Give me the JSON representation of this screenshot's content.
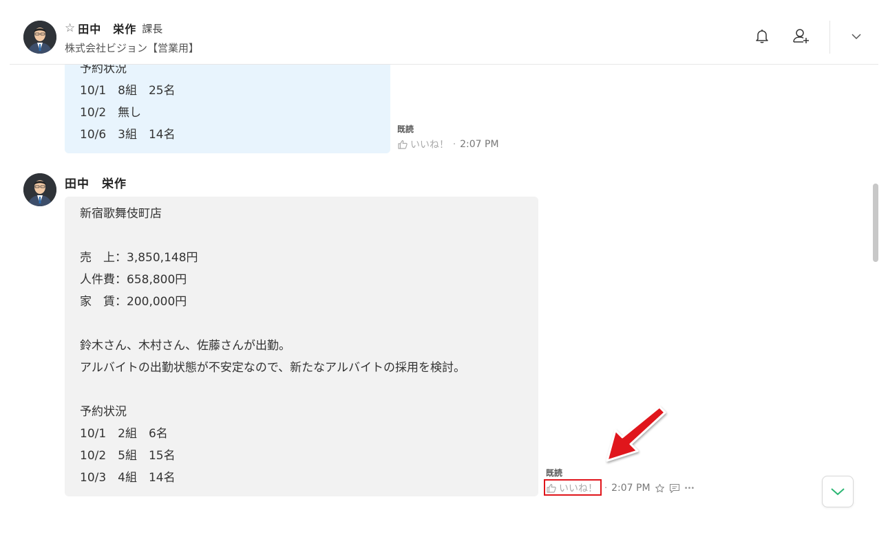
{
  "header": {
    "star_icon": "☆",
    "name": "田中　栄作",
    "title": "課長",
    "company": "株式会社ビジョン【営業用】",
    "icons": [
      "bell-icon",
      "add-user-icon",
      "chevron-down-icon"
    ]
  },
  "message1": {
    "lines": [
      "予約状況",
      "10/1　8組　25名",
      "10/2　無し",
      "10/6　3組　14名"
    ],
    "read": "既読",
    "like": "いいね！",
    "time": "2:07 PM"
  },
  "message2": {
    "sender": "田中　栄作",
    "lines": [
      "新宿歌舞伎町店",
      "",
      "売　上：3,850,148円",
      "人件費：658,800円",
      "家　賃：200,000円",
      "",
      "鈴木さん、木村さん、佐藤さんが出勤。",
      "アルバイトの出勤状態が不安定なので、新たなアルバイトの採用を検討。",
      "",
      "予約状況",
      "10/1　2組　6名",
      "10/2　5組　15名",
      "10/3　4組　14名"
    ],
    "read": "既読",
    "like": "いいね！",
    "time": "2:07 PM",
    "more": "•••"
  },
  "annotation": {
    "arrow_color": "#e0141a",
    "box_color": "#e0141a"
  }
}
